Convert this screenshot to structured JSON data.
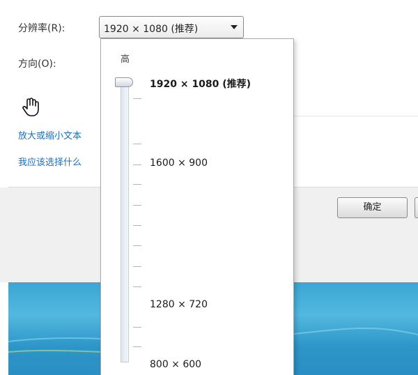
{
  "resolution": {
    "label": "分辨率(R):",
    "selected": "1920 × 1080 (推荐)"
  },
  "orientation": {
    "label": "方向(O):"
  },
  "links": [
    "放大或缩小文本",
    "我应该选择什么"
  ],
  "dropdown": {
    "high_label": "高",
    "options": [
      "1920 × 1080 (推荐)",
      "1600 × 900",
      "1280 × 720",
      "800 × 600"
    ],
    "slider_level_fraction": 1.0
  },
  "buttons": {
    "ok_label": "确定"
  },
  "icons": {
    "cursor": "hand-pointer-icon",
    "dropdown_arrow": "chevron-down-icon"
  },
  "colors": {
    "link": "#1f6fb5",
    "desktop": "#3aa6d4"
  }
}
